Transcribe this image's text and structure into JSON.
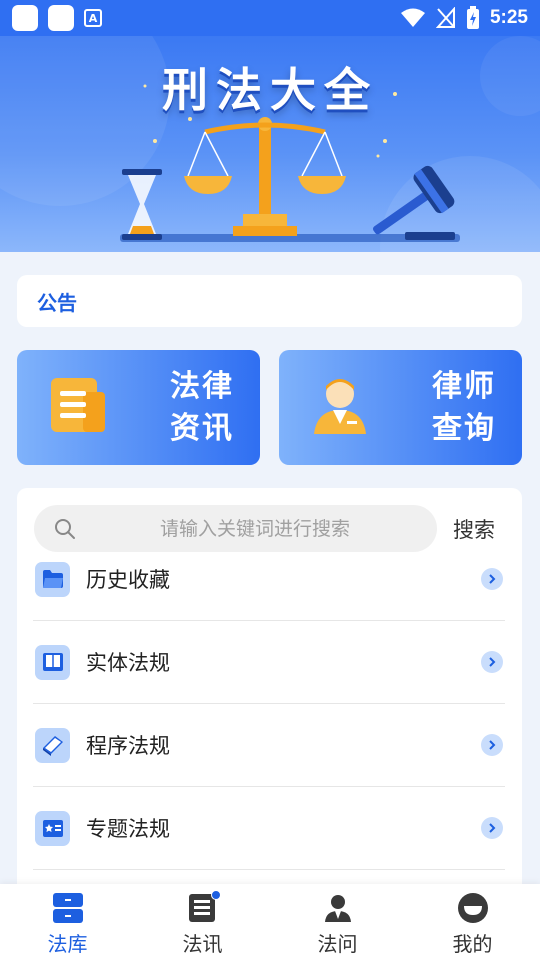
{
  "status_bar": {
    "time": "5:25",
    "icons": [
      "app-square-icon",
      "app-square-icon",
      "font-a-icon",
      "wifi-icon",
      "no-signal-icon",
      "battery-charging-icon"
    ]
  },
  "banner": {
    "title": "刑法大全"
  },
  "notice": {
    "label": "公告"
  },
  "cards": [
    {
      "line1": "法律",
      "line2": "资讯",
      "icon": "document-icon"
    },
    {
      "line1": "律师",
      "line2": "查询",
      "icon": "lawyer-icon"
    }
  ],
  "search": {
    "placeholder": "请输入关键词进行搜索",
    "button_label": "搜索"
  },
  "list": [
    {
      "label": "历史收藏",
      "icon": "folder-icon"
    },
    {
      "label": "实体法规",
      "icon": "book-icon"
    },
    {
      "label": "程序法规",
      "icon": "book-stack-icon"
    },
    {
      "label": "专题法规",
      "icon": "star-book-icon"
    }
  ],
  "nav": [
    {
      "label": "法库",
      "icon": "library-icon",
      "active": true
    },
    {
      "label": "法讯",
      "icon": "news-icon",
      "active": false,
      "badge": true
    },
    {
      "label": "法问",
      "icon": "lawyer-person-icon",
      "active": false
    },
    {
      "label": "我的",
      "icon": "profile-icon",
      "active": false
    }
  ],
  "colors": {
    "primary": "#2f6ff2",
    "accent": "#1d5fe0",
    "background": "#eef3fb"
  }
}
